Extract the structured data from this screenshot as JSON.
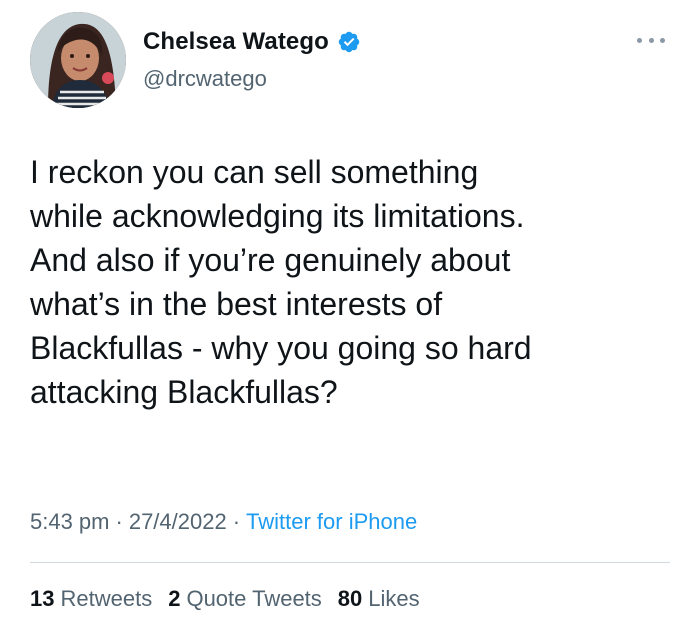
{
  "user": {
    "display_name": "Chelsea Watego",
    "handle": "@drcwatego",
    "verified": true,
    "avatar_icon": "profile-photo"
  },
  "tweet": {
    "text": "I reckon you can sell something\nwhile acknowledging its limitations.\nAnd also if you’re genuinely about\nwhat’s in the best interests of\nBlackfullas - why you going so hard\nattacking Blackfullas?"
  },
  "meta": {
    "time": "5:43 pm",
    "separator": "·",
    "date": "27/4/2022",
    "source": "Twitter for iPhone"
  },
  "stats": {
    "retweets_count": "13",
    "retweets_label": "Retweets",
    "quotes_count": "2",
    "quotes_label": "Quote Tweets",
    "likes_count": "80",
    "likes_label": "Likes"
  },
  "colors": {
    "accent": "#1d9bf0",
    "text": "#0f1419",
    "secondary": "#536471",
    "divider": "#cfd9de"
  }
}
